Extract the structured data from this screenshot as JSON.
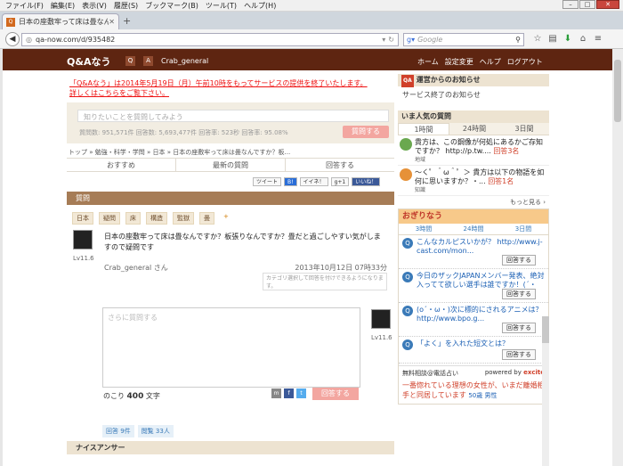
{
  "menubar": {
    "items": [
      "ファイル(F)",
      "編集(E)",
      "表示(V)",
      "履歴(S)",
      "ブックマーク(B)",
      "ツール(T)",
      "ヘルプ(H)"
    ]
  },
  "tab": {
    "title": "日本の座敷牢って床は畳なん..."
  },
  "address": {
    "url": "qa-now.com/d/935482"
  },
  "search": {
    "placeholder": "Google"
  },
  "site": {
    "logo_main": "Q&Aなう",
    "user": "Crab_general",
    "nav": [
      "ホーム",
      "設定変更",
      "ヘルプ",
      "ログアウト"
    ]
  },
  "notice": {
    "line1": "「Q&Aなう」は2014年5月19日（月）午前10時をもってサービスの提供を終了いたします。",
    "line2": "詳しくはこちらをご覧下さい。"
  },
  "qsearch": {
    "placeholder": "知りたいことを質問してみよう",
    "stats": "質問数: 951,571件 回答数: 5,693,477件 回答率: 523秒 回答率: 95.08%",
    "button": "質問する"
  },
  "breadcrumb": "トップ » 勉強・科学・学問 » 日本 » 日本の座敷牢って床は畳なんですか？板...",
  "tabs": [
    "おすすめ",
    "最新の質問",
    "回答する"
  ],
  "social": [
    "ツイート",
    "B!",
    "イイネ！",
    "g+1",
    "いいね！"
  ],
  "question": {
    "head": "質問",
    "tags": [
      "日本",
      "疑問",
      "床",
      "構造",
      "監獄",
      "畳"
    ],
    "tag_add": "+",
    "level": "Lv11.6",
    "body": "日本の座敷牢って床は畳なんですか？板張りなんですか？畳だと過ごしやすい気がしますので疑問です",
    "author": "Crab_general さん",
    "date": "2013年10月12日 07時33分",
    "notify": "カテゴリ選択して回答を付けできるようになります。"
  },
  "reply": {
    "placeholder": "さらに質問する",
    "level": "Lv11.6",
    "chars_pre": "のこり",
    "chars_num": "400",
    "chars_post": "文字",
    "button": "回答する"
  },
  "counts": {
    "answers": "回答 9件",
    "views": "閲覧 33人"
  },
  "nice_answer": "ナイスアンサー",
  "right": {
    "notice_head": "運営からのお知らせ",
    "notice_qa": "QA",
    "notice_text": "サービス終了のお知らせ",
    "popular_head": "いま人気の質問",
    "popular_tabs": [
      "1時間",
      "24時間",
      "3日間"
    ],
    "popular": [
      {
        "cat": "地域",
        "text": "貴方は、この鋼像が何処にあるかご存知ですか？ http://p.tw....",
        "ans": "回答3名"
      },
      {
        "cat": "知識",
        "text": "～く゜＾ω＾゜＞ 貴方は以下の物語を如何に思いますか？・...",
        "ans": "回答1名"
      }
    ],
    "more": "もっと見る ›",
    "ogiri_head": "おぎりなう",
    "ogiri_tabs": [
      "3時間",
      "24時間",
      "3日間"
    ],
    "ogiri": [
      {
        "text": "こんなカルピスいかが？ http://www.j-cast.com/mon...",
        "btn": "回答する"
      },
      {
        "text": "今日のザックJAPANメンバー発表、絶対入ってて欲しい選手は誰ですか！(´・",
        "btn": "回答する"
      },
      {
        "text": "(o´・ω・)次に標的にされるアニメは？ http://www.bpo.g...",
        "btn": "回答する"
      },
      {
        "text": "「よく」を入れた短文とは？",
        "btn": "回答する"
      }
    ],
    "phone_head": "無料相談@電話占い",
    "powered": "powered by",
    "excite": "excite",
    "phone_text": "一番惚れている理想の女性が、いまだ離婚相手と同居しています",
    "phone_age": "50歳 男性"
  }
}
